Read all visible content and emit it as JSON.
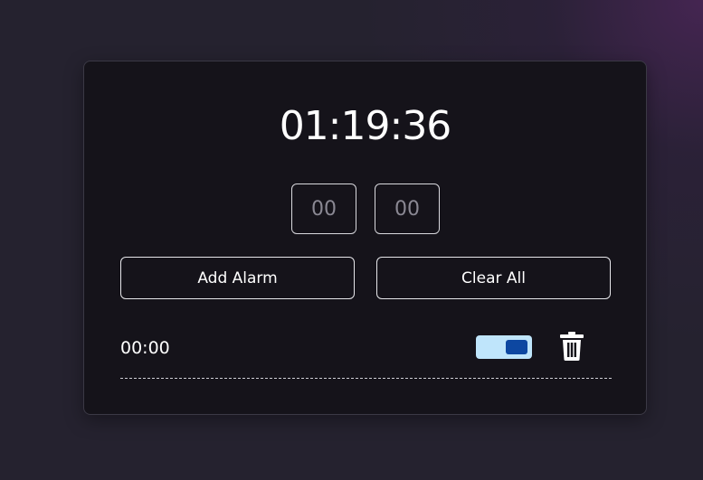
{
  "clock": {
    "time": "01:19:36"
  },
  "inputs": {
    "hour_placeholder": "00",
    "minute_placeholder": "00"
  },
  "buttons": {
    "add_label": "Add Alarm",
    "clear_label": "Clear All"
  },
  "alarms": [
    {
      "time": "00:00",
      "enabled": true,
      "toggle_track_color": "#bfe5fb",
      "toggle_knob_color": "#0d47a1",
      "delete_icon": "trash-icon"
    }
  ],
  "colors": {
    "background": "#25222f",
    "card": "#15131a",
    "text": "#ffffff"
  }
}
